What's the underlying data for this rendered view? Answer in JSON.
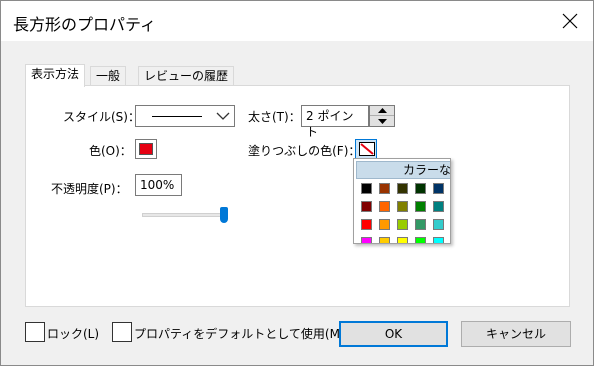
{
  "window": {
    "title": "長方形のプロパティ"
  },
  "tabs": [
    {
      "label": "表示方法",
      "active": true
    },
    {
      "label": "一般",
      "active": false
    },
    {
      "label": "レビューの履歴",
      "active": false
    }
  ],
  "form": {
    "style_label": "スタイル(S)：",
    "thickness_label": "太さ(T)：",
    "thickness_value": "2 ポイント",
    "color_label": "色(O)：",
    "line_color": "#e60012",
    "fill_color_label": "塗りつぶしの色(F)：",
    "opacity_label": "不透明度(P)：",
    "opacity_value": "100%",
    "opacity_fraction": 1.0
  },
  "palette": {
    "no_color_label": "カラーなし",
    "rows": [
      [
        "#000000",
        "#993300",
        "#333300",
        "#003300",
        "#003366"
      ],
      [
        "#800000",
        "#ff6600",
        "#808000",
        "#008000",
        "#008080"
      ],
      [
        "#ff0000",
        "#ff9900",
        "#99cc00",
        "#339966",
        "#33cccc"
      ],
      [
        "#ff00ff",
        "#ffcc00",
        "#ffff00",
        "#00ff00",
        "#00ffff"
      ]
    ]
  },
  "footer": {
    "lock_label": "ロック(L)",
    "default_label": "プロパティをデフォルトとして使用(M)",
    "ok_label": "OK",
    "cancel_label": "キャンセル"
  }
}
